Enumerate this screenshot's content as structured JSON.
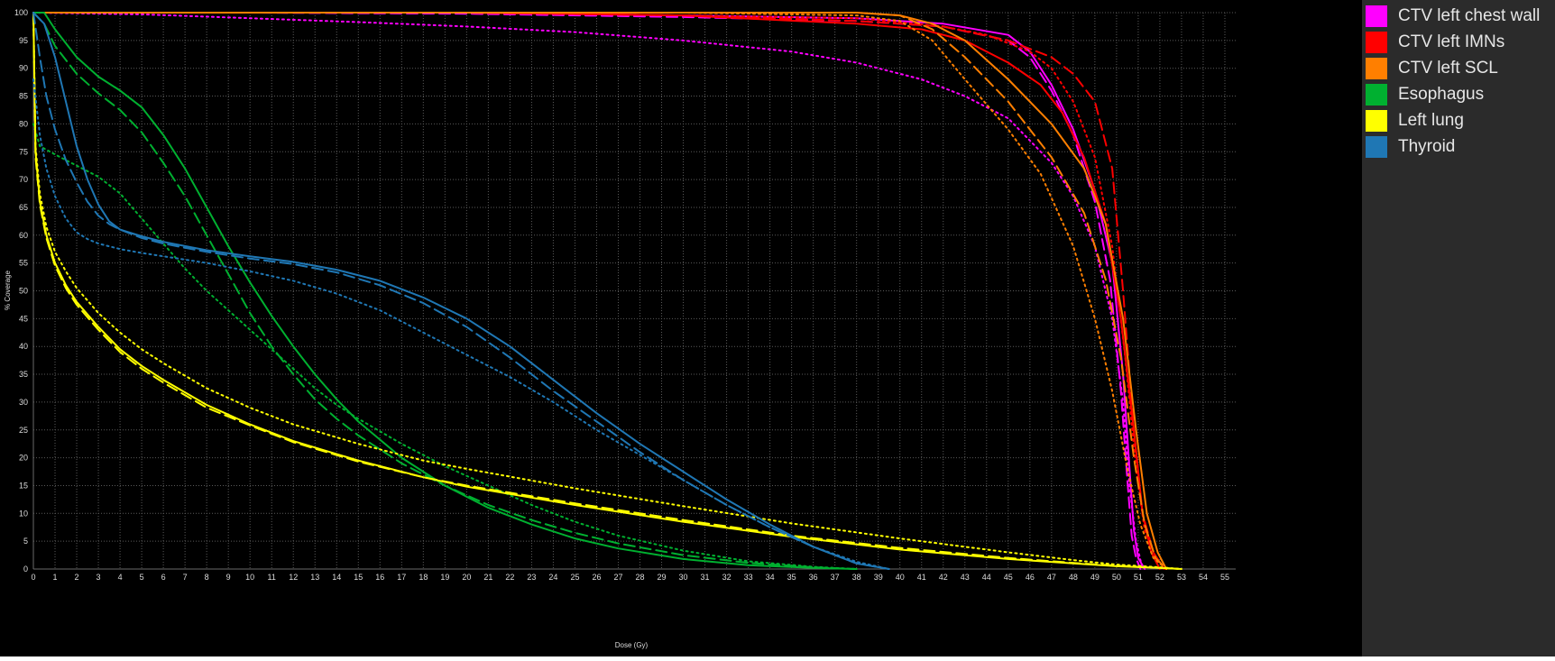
{
  "chart_data": {
    "type": "line",
    "xlabel": "Dose (Gy)",
    "ylabel": "% Coverage",
    "xlim": [
      0,
      55.5
    ],
    "ylim": [
      0,
      100
    ],
    "x_ticks": [
      "0",
      "1",
      "2",
      "3",
      "4",
      "5",
      "6",
      "7",
      "8",
      "9",
      "10",
      "11",
      "12",
      "13",
      "14",
      "15",
      "16",
      "17",
      "18",
      "19",
      "20",
      "21",
      "22",
      "23",
      "24",
      "25",
      "26",
      "27",
      "28",
      "29",
      "30",
      "31",
      "32",
      "33",
      "34",
      "35",
      "36",
      "37",
      "38",
      "39",
      "40",
      "41",
      "42",
      "43",
      "44",
      "45",
      "46",
      "47",
      "48",
      "49",
      "50",
      "51",
      "52",
      "53",
      "54",
      "55"
    ],
    "y_ticks": [
      "0",
      "5",
      "10",
      "15",
      "20",
      "25",
      "30",
      "35",
      "40",
      "45",
      "50",
      "55",
      "60",
      "65",
      "70",
      "75",
      "80",
      "85",
      "90",
      "95",
      "100"
    ],
    "grid": true,
    "legend_position": "right",
    "line_styles": [
      "solid",
      "dashed",
      "dotted"
    ],
    "legend": [
      {
        "label": "CTV left chest wall",
        "color": "#ff00ff"
      },
      {
        "label": "CTV left IMNs",
        "color": "#ff0000"
      },
      {
        "label": "CTV left SCL",
        "color": "#ff7f00"
      },
      {
        "label": "Esophagus",
        "color": "#00b030"
      },
      {
        "label": "Left lung",
        "color": "#ffff00"
      },
      {
        "label": "Thyroid",
        "color": "#1f77b4"
      }
    ],
    "series": [
      {
        "structure": "CTV left chest wall",
        "style": "solid",
        "color": "#ff00ff",
        "x": [
          0,
          10,
          20,
          30,
          38,
          42,
          45,
          46,
          47,
          48,
          49,
          49.8,
          50.3,
          50.6,
          50.8,
          51.0,
          51.3
        ],
        "y": [
          100,
          100,
          100,
          99.5,
          99,
          98,
          96,
          93,
          87,
          79,
          68,
          55,
          35,
          18,
          7,
          2,
          0
        ]
      },
      {
        "structure": "CTV left chest wall",
        "style": "dashed",
        "color": "#ff00ff",
        "x": [
          0,
          10,
          20,
          30,
          38,
          42,
          45,
          46,
          47,
          48,
          49,
          49.7,
          50.2,
          50.5,
          50.7,
          50.9,
          51.1
        ],
        "y": [
          100,
          100,
          99.8,
          99.2,
          98.5,
          97.5,
          95,
          92,
          86,
          78,
          66,
          52,
          32,
          16,
          6,
          2,
          0
        ]
      },
      {
        "structure": "CTV left chest wall",
        "style": "dotted",
        "color": "#ff00ff",
        "x": [
          0,
          5,
          10,
          15,
          20,
          25,
          30,
          35,
          38,
          41,
          43,
          45,
          47,
          48,
          49,
          49.8,
          50.3,
          50.6,
          50.9,
          51.2
        ],
        "y": [
          100,
          99.7,
          99,
          98.3,
          97.5,
          96.5,
          95,
          93,
          91,
          88,
          85,
          81,
          73,
          67,
          58,
          45,
          30,
          15,
          5,
          0
        ]
      },
      {
        "structure": "CTV left IMNs",
        "style": "solid",
        "color": "#ff0000",
        "x": [
          0,
          10,
          20,
          30,
          38,
          41,
          43,
          45,
          46.5,
          47.5,
          48.5,
          49.5,
          50.2,
          50.8,
          51.2,
          51.6,
          52.0
        ],
        "y": [
          100,
          100,
          100,
          99.5,
          98,
          97,
          95,
          91,
          87,
          82,
          74,
          62,
          45,
          25,
          10,
          3,
          0
        ]
      },
      {
        "structure": "CTV left IMNs",
        "style": "dashed",
        "color": "#ff0000",
        "x": [
          0,
          10,
          20,
          30,
          38,
          42,
          45,
          47,
          48,
          49,
          49.8,
          50.3,
          50.8,
          51.2,
          51.7,
          52.2
        ],
        "y": [
          100,
          100,
          100,
          99.5,
          98.5,
          97.5,
          95,
          92,
          89,
          84,
          72,
          50,
          25,
          10,
          3,
          0
        ]
      },
      {
        "structure": "CTV left IMNs",
        "style": "dotted",
        "color": "#ff0000",
        "x": [
          0,
          10,
          20,
          30,
          38,
          42,
          44,
          46,
          47,
          48,
          49,
          49.8,
          50.4,
          50.9,
          51.3,
          51.8,
          52.3
        ],
        "y": [
          100,
          100,
          100,
          99.5,
          99,
          97.5,
          96,
          93,
          90,
          84,
          74,
          58,
          38,
          18,
          7,
          2,
          0
        ]
      },
      {
        "structure": "CTV left SCL",
        "style": "solid",
        "color": "#ff7f00",
        "x": [
          0,
          10,
          20,
          30,
          38,
          40,
          41.5,
          43,
          45,
          47,
          48.5,
          49.5,
          50.3,
          50.9,
          51.4,
          51.9,
          52.3
        ],
        "y": [
          100,
          100,
          100,
          100,
          100,
          99.5,
          98,
          95,
          88,
          80,
          72,
          62,
          45,
          25,
          10,
          3,
          0
        ]
      },
      {
        "structure": "CTV left SCL",
        "style": "dashed",
        "color": "#ff7f00",
        "x": [
          0,
          10,
          20,
          30,
          38,
          40,
          41.5,
          43,
          45,
          47,
          48.5,
          49.5,
          50.2,
          50.8,
          51.3,
          51.8,
          52.3
        ],
        "y": [
          100,
          100,
          100,
          100,
          100,
          99.5,
          97,
          92,
          84,
          74,
          64,
          52,
          38,
          20,
          8,
          2,
          0
        ]
      },
      {
        "structure": "CTV left SCL",
        "style": "dotted",
        "color": "#ff7f00",
        "x": [
          0,
          10,
          20,
          30,
          38,
          40,
          41.5,
          43,
          45,
          46.5,
          48,
          49,
          49.8,
          50.5,
          51.1,
          51.7,
          52.3
        ],
        "y": [
          100,
          100,
          100,
          100,
          99.5,
          98.5,
          95,
          88,
          79,
          71,
          58,
          45,
          32,
          18,
          8,
          2,
          0
        ]
      },
      {
        "structure": "Esophagus",
        "style": "solid",
        "color": "#00b030",
        "x": [
          0,
          0.5,
          1,
          2,
          3,
          4,
          5,
          6,
          7,
          8,
          9,
          10,
          11,
          12,
          13,
          14,
          15,
          17,
          19,
          21,
          23,
          25,
          27,
          30,
          33,
          36,
          38
        ],
        "y": [
          100,
          100,
          97,
          92,
          88.5,
          86,
          83,
          78,
          72,
          65,
          58,
          51.5,
          45.5,
          40,
          35,
          30.5,
          26.5,
          20,
          15,
          11,
          8,
          5.5,
          3.7,
          1.8,
          0.7,
          0.2,
          0
        ]
      },
      {
        "structure": "Esophagus",
        "style": "dashed",
        "color": "#00b030",
        "x": [
          0,
          0.5,
          1,
          2,
          3,
          4,
          5,
          6,
          7,
          8,
          9,
          10,
          11,
          12,
          13,
          14,
          15,
          17,
          19,
          21,
          23,
          25,
          27,
          30,
          33,
          36,
          38
        ],
        "y": [
          100,
          98,
          94,
          89,
          85.5,
          82.5,
          78.5,
          73,
          67,
          60,
          53,
          46,
          40,
          35,
          30.5,
          27,
          24,
          19,
          15,
          11.5,
          8.8,
          6.5,
          4.6,
          2.5,
          1.1,
          0.3,
          0
        ]
      },
      {
        "structure": "Esophagus",
        "style": "dotted",
        "color": "#00b030",
        "x": [
          0,
          0.3,
          1,
          2,
          3,
          4,
          5,
          6,
          7,
          8,
          9,
          10,
          11,
          12,
          13,
          14,
          15,
          17,
          19,
          21,
          23,
          25,
          27,
          30,
          33,
          36,
          38
        ],
        "y": [
          80,
          76,
          74.5,
          72.5,
          70.5,
          67.5,
          63,
          58.5,
          54,
          50,
          46.5,
          43,
          39.5,
          36,
          32.5,
          29.5,
          27,
          22.5,
          18.5,
          15,
          11.5,
          8.5,
          6,
          3.3,
          1.4,
          0.4,
          0
        ]
      },
      {
        "structure": "Left lung",
        "style": "solid",
        "color": "#ffff00",
        "x": [
          0,
          0.1,
          0.3,
          0.6,
          1,
          1.5,
          2,
          3,
          4,
          5,
          6,
          8,
          10,
          12,
          15,
          18,
          20,
          25,
          30,
          35,
          40,
          45,
          48,
          50,
          52,
          53
        ],
        "y": [
          100,
          75,
          66,
          60,
          55,
          51,
          48,
          43.5,
          39.5,
          36.5,
          34,
          29.5,
          26,
          23,
          19.5,
          16.5,
          14.8,
          11.5,
          8.5,
          5.8,
          3.5,
          1.8,
          1.0,
          0.5,
          0.2,
          0
        ]
      },
      {
        "structure": "Left lung",
        "style": "dashed",
        "color": "#ffff00",
        "x": [
          0,
          0.1,
          0.3,
          0.6,
          1,
          1.5,
          2,
          3,
          4,
          5,
          6,
          8,
          10,
          12,
          15,
          18,
          20,
          25,
          30,
          35,
          40,
          45,
          48,
          50,
          52,
          53
        ],
        "y": [
          100,
          74,
          65.5,
          59.5,
          54.5,
          50.5,
          47.5,
          43,
          39,
          36,
          33.5,
          29,
          25.8,
          22.8,
          19.3,
          16.5,
          15,
          11.8,
          8.8,
          6,
          3.8,
          2,
          1.1,
          0.6,
          0.2,
          0
        ]
      },
      {
        "structure": "Left lung",
        "style": "dotted",
        "color": "#ffff00",
        "x": [
          0,
          0.1,
          0.3,
          0.6,
          1,
          1.5,
          2,
          3,
          4,
          5,
          6,
          8,
          10,
          12,
          15,
          18,
          20,
          25,
          30,
          35,
          40,
          45,
          48,
          50,
          52,
          53
        ],
        "y": [
          100,
          76,
          67.5,
          61.5,
          57,
          53.5,
          50.5,
          46,
          42.5,
          39.5,
          37,
          32.5,
          29,
          26,
          22.5,
          19.5,
          18,
          14.5,
          11.3,
          8.2,
          5.5,
          3,
          1.6,
          0.8,
          0.3,
          0
        ]
      },
      {
        "structure": "Thyroid",
        "style": "solid",
        "color": "#1f77b4",
        "x": [
          0,
          0.5,
          1,
          1.5,
          2,
          2.5,
          3,
          3.5,
          4,
          5,
          6,
          8,
          10,
          12,
          14,
          16,
          18,
          20,
          22,
          24,
          26,
          28,
          30,
          32,
          34,
          36,
          38,
          39.5
        ],
        "y": [
          100,
          98,
          92,
          84,
          76,
          70,
          65.5,
          62.5,
          61,
          59.8,
          58.8,
          57.3,
          56.2,
          55.2,
          53.8,
          51.8,
          48.8,
          45,
          40,
          34,
          28,
          22.5,
          17.5,
          12.5,
          8,
          4,
          1,
          0
        ]
      },
      {
        "structure": "Thyroid",
        "style": "dashed",
        "color": "#1f77b4",
        "x": [
          0,
          0.3,
          0.6,
          1,
          1.5,
          2,
          2.5,
          3,
          3.5,
          4,
          5,
          6,
          8,
          10,
          12,
          14,
          16,
          18,
          20,
          22,
          24,
          26,
          28,
          30,
          32,
          34,
          36,
          38,
          39.5
        ],
        "y": [
          100,
          92,
          85,
          79,
          73.5,
          69.5,
          66,
          63.5,
          62,
          61,
          59.5,
          58.5,
          57,
          55.8,
          54.8,
          53.3,
          51,
          47.8,
          43.5,
          38,
          32,
          26.5,
          21,
          16,
          11.5,
          7.5,
          4,
          1,
          0
        ]
      },
      {
        "structure": "Thyroid",
        "style": "dotted",
        "color": "#1f77b4",
        "x": [
          0,
          0.3,
          0.6,
          1,
          1.5,
          2,
          2.5,
          3,
          4,
          5,
          6,
          8,
          10,
          12,
          14,
          16,
          18,
          20,
          22,
          24,
          26,
          28,
          30,
          32,
          34,
          36,
          38,
          39.5
        ],
        "y": [
          88,
          78,
          72,
          67,
          63,
          60.5,
          59.3,
          58.5,
          57.5,
          56.8,
          56.2,
          55,
          53.5,
          51.8,
          49.5,
          46.5,
          42.5,
          38.5,
          34.5,
          30,
          25,
          20.5,
          16,
          11.5,
          7.5,
          4,
          1.3,
          0
        ]
      }
    ]
  }
}
